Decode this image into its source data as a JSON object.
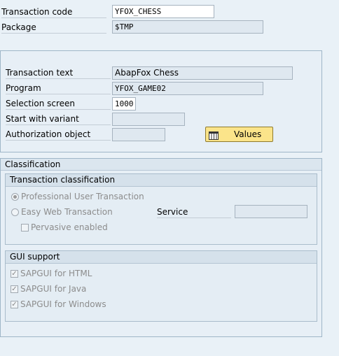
{
  "header": {
    "transaction_code": {
      "label": "Transaction code",
      "value": "YFOX_CHESS"
    },
    "package": {
      "label": "Package",
      "value": "$TMP"
    }
  },
  "main": {
    "transaction_text": {
      "label": "Transaction text",
      "value": "AbapFox Chess"
    },
    "program": {
      "label": "Program",
      "value": "YFOX_GAME02"
    },
    "selection_screen": {
      "label": "Selection screen",
      "value": "1000"
    },
    "start_with_variant": {
      "label": "Start with variant",
      "value": ""
    },
    "authorization_object": {
      "label": "Authorization object",
      "value": ""
    },
    "values_button": {
      "label": "Values",
      "icon": "table-icon"
    }
  },
  "classification": {
    "title": "Classification",
    "transaction_classification": {
      "title": "Transaction classification",
      "professional_user": {
        "label": "Professional User Transaction",
        "selected": true
      },
      "easy_web": {
        "label": "Easy Web Transaction",
        "selected": false
      },
      "pervasive": {
        "label": "Pervasive enabled",
        "checked": false
      },
      "service": {
        "label": "Service",
        "value": ""
      }
    },
    "gui_support": {
      "title": "GUI support",
      "html": {
        "label": "SAPGUI for HTML",
        "checked": true
      },
      "java": {
        "label": "SAPGUI for Java",
        "checked": true
      },
      "windows": {
        "label": "SAPGUI for Windows",
        "checked": true
      }
    }
  },
  "colors": {
    "background": "#e9f1f7",
    "button": "#fbe48a",
    "disabled_text": "#8c8c8c"
  }
}
